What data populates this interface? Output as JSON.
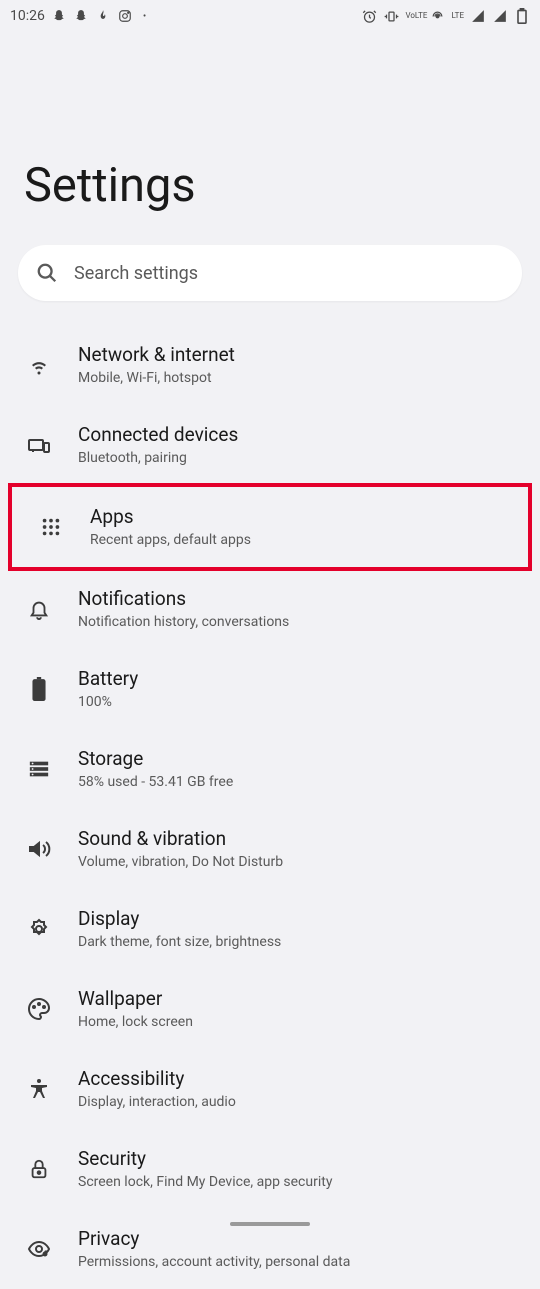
{
  "status_bar": {
    "time": "10:26",
    "lte": "LTE",
    "volte": "VoLTE"
  },
  "page": {
    "title": "Settings"
  },
  "search": {
    "placeholder": "Search settings"
  },
  "items": [
    {
      "title": "Network & internet",
      "subtitle": "Mobile, Wi-Fi, hotspot"
    },
    {
      "title": "Connected devices",
      "subtitle": "Bluetooth, pairing"
    },
    {
      "title": "Apps",
      "subtitle": "Recent apps, default apps"
    },
    {
      "title": "Notifications",
      "subtitle": "Notification history, conversations"
    },
    {
      "title": "Battery",
      "subtitle": "100%"
    },
    {
      "title": "Storage",
      "subtitle": "58% used - 53.41 GB free"
    },
    {
      "title": "Sound & vibration",
      "subtitle": "Volume, vibration, Do Not Disturb"
    },
    {
      "title": "Display",
      "subtitle": "Dark theme, font size, brightness"
    },
    {
      "title": "Wallpaper",
      "subtitle": "Home, lock screen"
    },
    {
      "title": "Accessibility",
      "subtitle": "Display, interaction, audio"
    },
    {
      "title": "Security",
      "subtitle": "Screen lock, Find My Device, app security"
    },
    {
      "title": "Privacy",
      "subtitle": "Permissions, account activity, personal data"
    }
  ],
  "highlighted_index": 2
}
